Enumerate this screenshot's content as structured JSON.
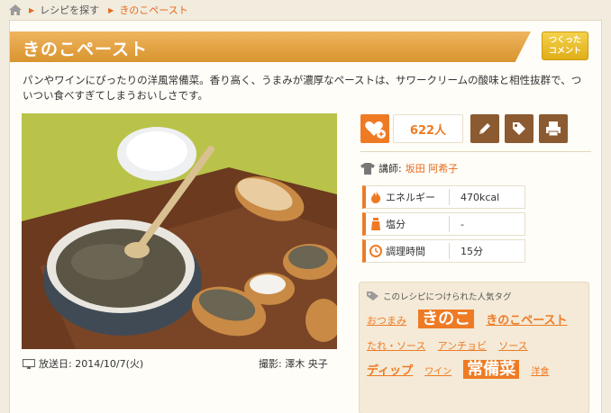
{
  "breadcrumb": {
    "items": [
      {
        "label": "レシピを探す"
      },
      {
        "label": "きのこペースト"
      }
    ]
  },
  "recipe": {
    "title": "きのこペースト",
    "comment_button": [
      "つくった",
      "コメント"
    ],
    "description": "パンやワインにぴったりの洋風常備菜。香り高く、うまみが濃厚なペーストは、サワークリームの酸味と相性抜群で、ついつい食べすぎてしまうおいしさです。",
    "photo_alt": "",
    "broadcast_date": "放送日: 2014/10/7(火)",
    "photographer": "撮影: 澤木 央子"
  },
  "actions": {
    "favorite_count": "622人",
    "icons": [
      "heart-plus-icon",
      "pencil-icon",
      "tag-icon",
      "printer-icon"
    ]
  },
  "lecturer": {
    "label": "講師:",
    "name": "坂田 阿希子"
  },
  "info": [
    {
      "label": "エネルギー",
      "value": "470kcal",
      "icon": "flame-icon"
    },
    {
      "label": "塩分",
      "value": "-",
      "icon": "salt-icon"
    },
    {
      "label": "調理時間",
      "value": "15分",
      "icon": "clock-icon"
    }
  ],
  "tags": {
    "heading": "このレシピにつけられた人気タグ",
    "items": [
      {
        "label": "おつまみ",
        "size": "s1"
      },
      {
        "label": "きのこ",
        "size": "hl"
      },
      {
        "label": "きのこペースト",
        "size": "s2"
      },
      {
        "label": "たれ・ソース",
        "size": "s1"
      },
      {
        "label": "アンチョビ",
        "size": "s1"
      },
      {
        "label": "ソース",
        "size": "s1"
      },
      {
        "label": "ディップ",
        "size": "s2"
      },
      {
        "label": "ワイン",
        "size": "small"
      },
      {
        "label": "常備菜",
        "size": "hl"
      },
      {
        "label": "洋食",
        "size": "small"
      }
    ]
  },
  "colors": {
    "accent": "#ee7b24",
    "title_bar": "#d9952f",
    "tool_button": "#8b5a30",
    "comment_button": "#e0ae18"
  }
}
